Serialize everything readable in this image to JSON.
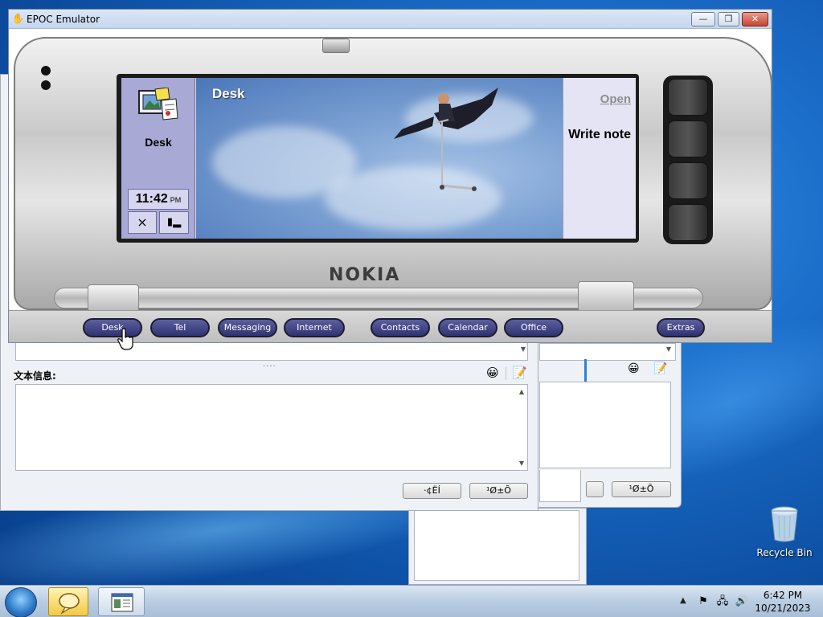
{
  "window": {
    "title": "EPOC Emulator",
    "controls": {
      "minimize": "—",
      "maximize": "❐",
      "close": "✕"
    }
  },
  "device": {
    "brand": "NOKIA",
    "screen": {
      "app_label": "Desk",
      "title": "Desk",
      "time": "11:42",
      "ampm": "PM",
      "commands": {
        "open": "Open",
        "write_note": "Write note"
      }
    },
    "function_keys": [
      "Desk",
      "Tel",
      "Messaging",
      "Internet",
      "Contacts",
      "Calendar",
      "Office",
      "Extras"
    ]
  },
  "chat": {
    "message_label": "文本信息:",
    "buttons": {
      "send_1": "·¢ËÍ",
      "send_2": "¹Ø±Õ"
    }
  },
  "bg_chat": {
    "buttons": {
      "send_2": "¹Ø±Õ"
    }
  },
  "desktop": {
    "recycle_bin": "Recycle Bin"
  },
  "taskbar": {
    "time": "6:42 PM",
    "date": "10/21/2023"
  },
  "icons": {
    "emoji": "smiley-icon",
    "edit": "edit-note-icon",
    "start": "windows-start-icon"
  },
  "colors": {
    "function_key": "#3c4080",
    "screen_side": "#a9a9d6",
    "taskbar": "#b9cde2"
  }
}
